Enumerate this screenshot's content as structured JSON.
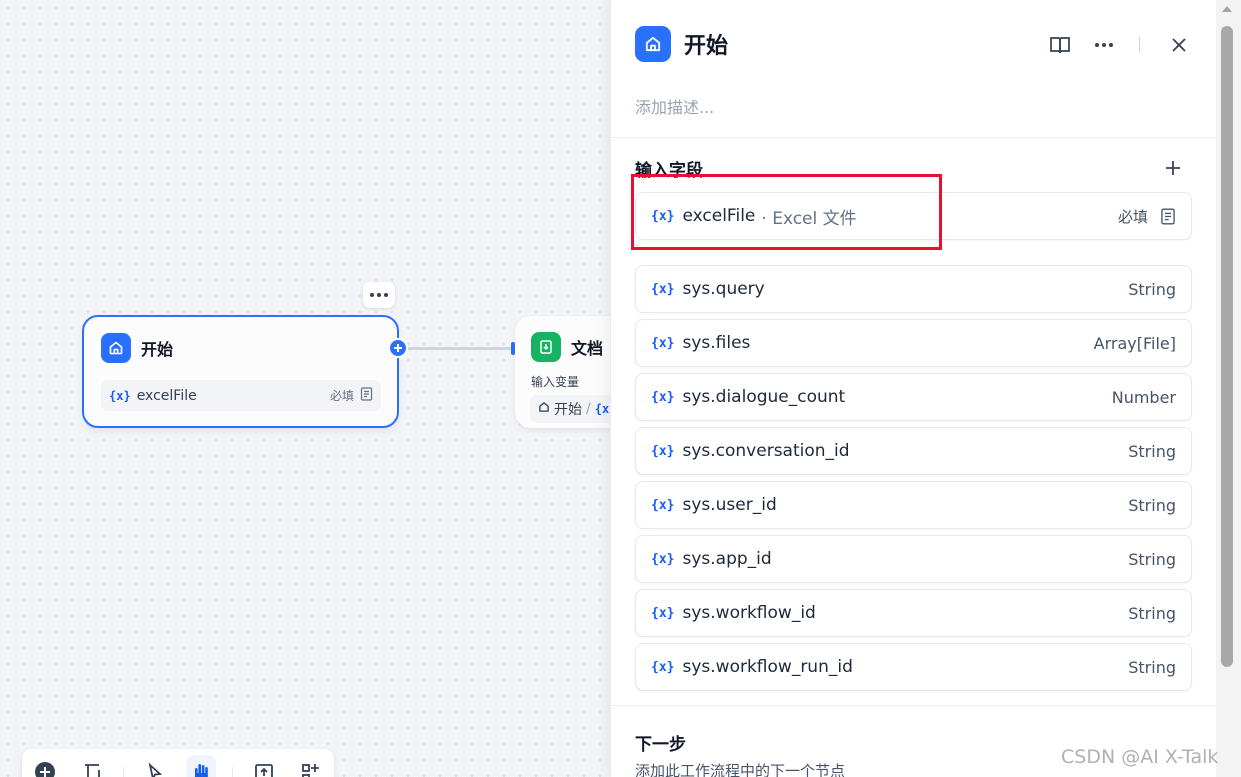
{
  "canvas": {
    "start_node": {
      "title": "开始",
      "variable": {
        "symbol": "{x}",
        "name": "excelFile",
        "required_label": "必填"
      }
    },
    "doc_node": {
      "title": "文档",
      "subtitle": "输入变量",
      "chip_source": "开始",
      "chip_separator": "/",
      "chip_symbol": "{x"
    },
    "toolbar": {
      "items": [
        "add-node",
        "note",
        "pointer",
        "hand",
        "export",
        "layout"
      ],
      "active": "hand"
    }
  },
  "panel": {
    "title": "开始",
    "description_placeholder": "添加描述...",
    "input_section_title": "输入字段",
    "fields": [
      {
        "symbol": "{x}",
        "name": "excelFile",
        "label": "· Excel 文件",
        "required_label": "必填",
        "highlighted": true
      },
      {
        "symbol": "{x}",
        "name": "sys.query",
        "type": "String"
      },
      {
        "symbol": "{x}",
        "name": "sys.files",
        "type": "Array[File]"
      },
      {
        "symbol": "{x}",
        "name": "sys.dialogue_count",
        "type": "Number"
      },
      {
        "symbol": "{x}",
        "name": "sys.conversation_id",
        "type": "String"
      },
      {
        "symbol": "{x}",
        "name": "sys.user_id",
        "type": "String"
      },
      {
        "symbol": "{x}",
        "name": "sys.app_id",
        "type": "String"
      },
      {
        "symbol": "{x}",
        "name": "sys.workflow_id",
        "type": "String"
      },
      {
        "symbol": "{x}",
        "name": "sys.workflow_run_id",
        "type": "String"
      }
    ],
    "next_step": {
      "title": "下一步",
      "description": "添加此工作流程中的下一个节点"
    }
  },
  "watermark": "CSDN @AI X-Talk",
  "colors": {
    "accent": "#2970ff",
    "doc_node": "#16b364",
    "highlight": "#e8112d"
  }
}
